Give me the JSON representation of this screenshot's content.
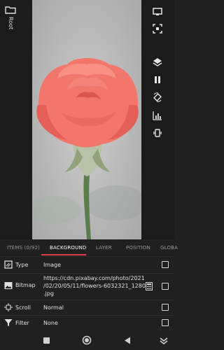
{
  "sidebar": {
    "root_label": "Root",
    "folder_icon": "folder-icon"
  },
  "photo": {
    "description_icon": "image-preview"
  },
  "toolbar": {
    "icons": [
      "monitor-icon",
      "fullscreen-icon",
      "layers-icon",
      "pause-icon",
      "rotate-icon",
      "chart-icon",
      "vibrate-icon"
    ]
  },
  "tabs": [
    {
      "label": "ITEMS (0/92)"
    },
    {
      "label": "BACKGROUND"
    },
    {
      "label": "LAYER"
    },
    {
      "label": "POSITION"
    },
    {
      "label": "GLOBA"
    }
  ],
  "rows": {
    "type": {
      "label": "Type",
      "value": "Image"
    },
    "bitmap": {
      "label": "Bitmap",
      "value_line1": "https://cdn.pixabay.com/photo/2021",
      "value_line2": "/02/20/05/11/flowers-6032321_1280",
      "value_line3": ".jpg"
    },
    "scroll": {
      "label": "Scroll",
      "value": "Normal"
    },
    "filter": {
      "label": "Filter",
      "value": "None"
    }
  },
  "colors": {
    "accent": "#e23b49",
    "rose": "#f2766b"
  }
}
